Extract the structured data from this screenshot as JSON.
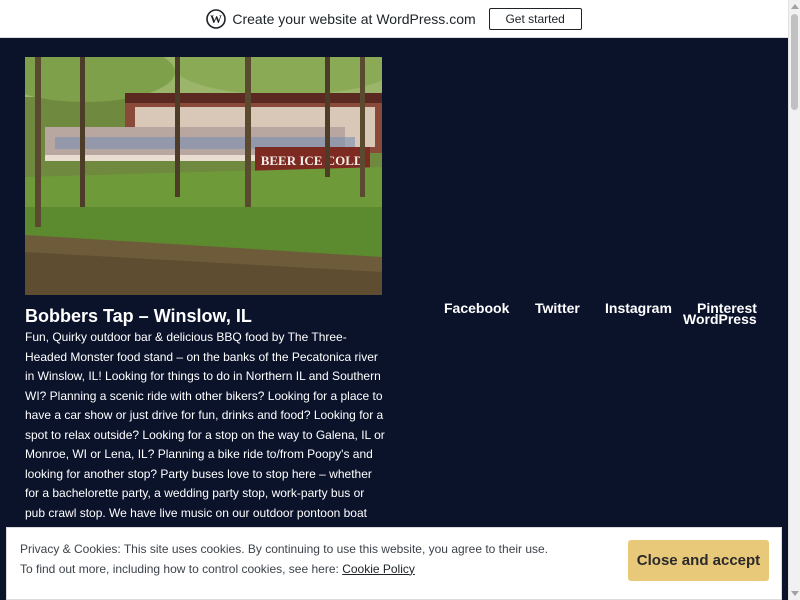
{
  "wp_banner": {
    "promo_text": "Create your website at WordPress.com",
    "cta_label": "Get started"
  },
  "site": {
    "title": "Bobbers Tap – Winslow, IL",
    "description": "Fun, Quirky outdoor bar & delicious BBQ food by The Three-Headed Monster food stand – on the banks of the Pecatonica river in Winslow, IL! Looking for things to do in Northern IL and Southern WI? Planning a scenic ride with other bikers? Looking for a place to have a car show or just drive for fun, drinks and food? Looking for a spot to relax outside? Looking for a stop on the way to Galena, IL or Monroe, WI or Lena, IL? Planning a bike ride to/from Poopy's and looking for another stop? Party buses love to stop here – whether for a bachelorette party, a wedding party stop, work-party bus or pub crawl stop. We have live music on our outdoor pontoon boat stage, and welcome all to our",
    "sign_text": "BEER ICE COLD"
  },
  "social_links": [
    "Facebook",
    "Twitter",
    "Instagram",
    "Pinterest",
    "WordPress"
  ],
  "cookie_notice": {
    "line1": "Privacy & Cookies: This site uses cookies. By continuing to use this website, you agree to their use.",
    "line2_prefix": "To find out more, including how to control cookies, see here: ",
    "policy_link": "Cookie Policy",
    "accept_label": "Close and accept"
  },
  "colors": {
    "page_background": "#0b132b",
    "accept_button": "#e8c97a",
    "text": "#ffffff"
  }
}
